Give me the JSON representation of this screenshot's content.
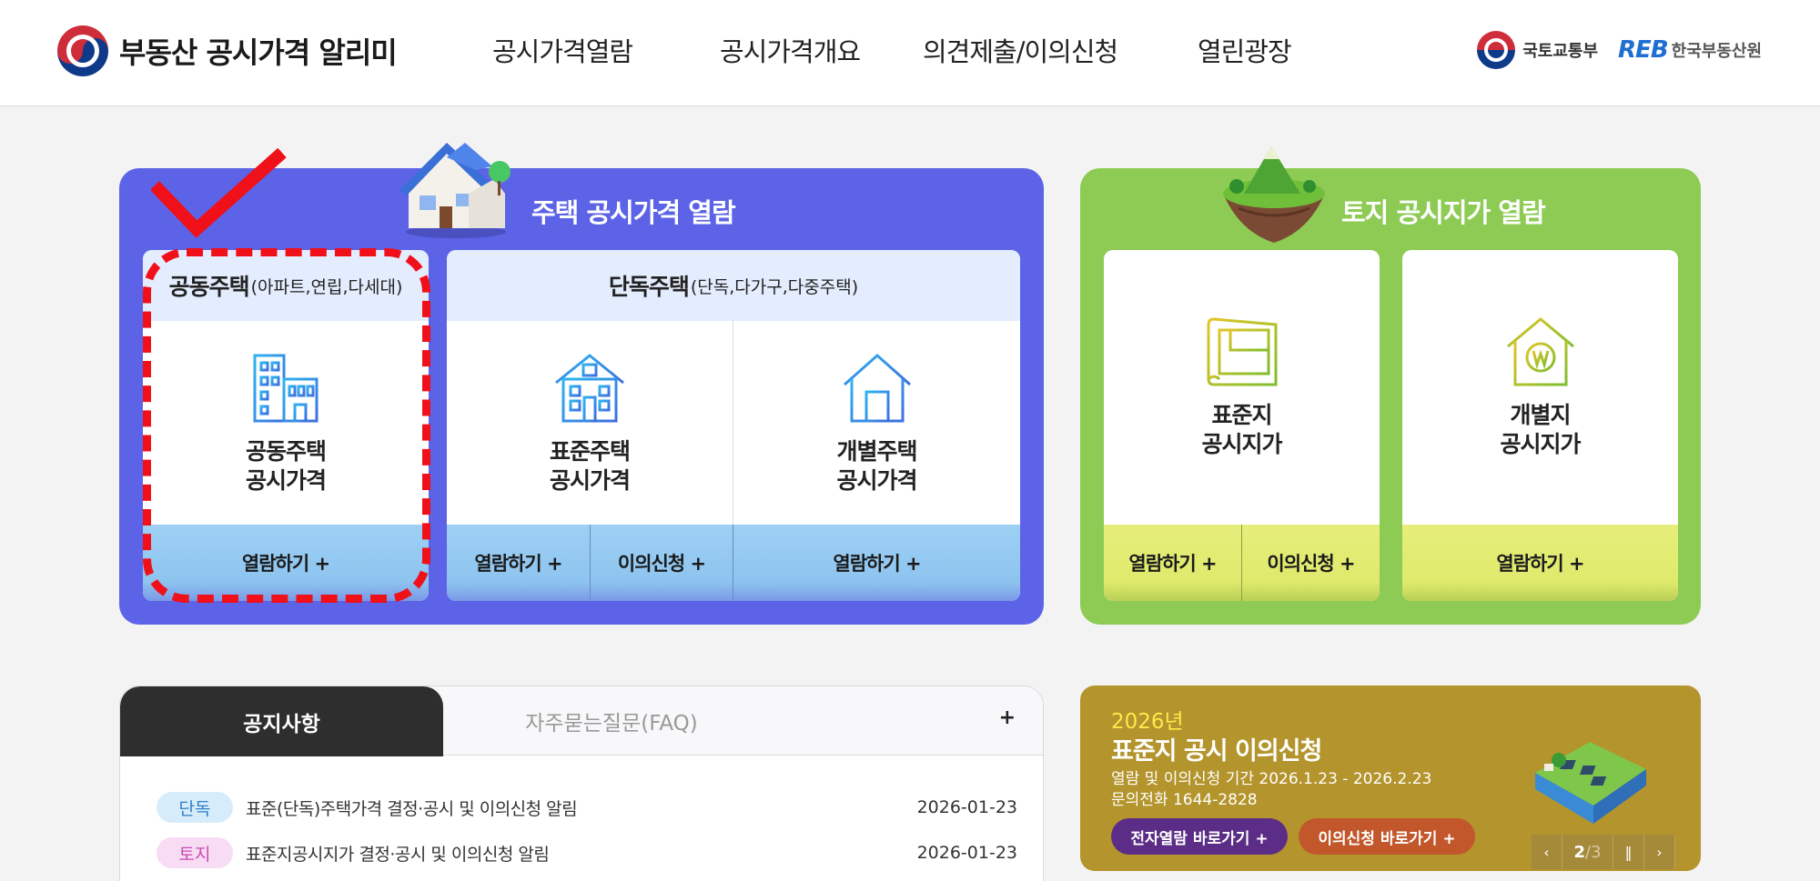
{
  "header": {
    "logo_text_regular": "부동산 공시가격 ",
    "logo_text_bold": "알리미",
    "nav": [
      "공시가격열람",
      "공시가격개요",
      "의견제출/이의신청",
      "열린광장"
    ],
    "ministry": "국토교통부",
    "reb_mark": "REB",
    "reb_text": "한국부동산원"
  },
  "housing": {
    "title": "주택 공시가격 열람",
    "apartment": {
      "head_main": "공동주택",
      "head_sub": "(아파트,연립,다세대)",
      "tile_label": "공동주택\n공시가격",
      "view_btn": "열람하기 +"
    },
    "detached": {
      "head_main": "단독주택",
      "head_sub": "(단독,다가구,다중주택)",
      "standard_label": "표준주택\n공시가격",
      "individual_label": "개별주택\n공시가격",
      "view_btn": "열람하기 +",
      "appeal_btn": "이의신청 +",
      "view_btn2": "열람하기 +"
    }
  },
  "land": {
    "title": "토지 공시지가 열람",
    "standard_label": "표준지\n공시지가",
    "individual_label": "개별지\n공시지가",
    "view_btn": "열람하기 +",
    "appeal_btn": "이의신청 +",
    "view_btn2": "열람하기 +"
  },
  "notice": {
    "tab_active": "공지사항",
    "tab_faq": "자주묻는질문(FAQ)",
    "more": "+",
    "rows": [
      {
        "badge": "단독",
        "text": "표준(단독)주택가격 결정·공시 및 이의신청 알림",
        "date": "2026-01-23"
      },
      {
        "badge": "토지",
        "text": "표준지공시지가 결정·공시 및 이의신청 알림",
        "date": "2026-01-23"
      }
    ]
  },
  "banner": {
    "year": "2026년",
    "title": "표준지 공시 이의신청",
    "line1": "열람 및 이의신청 기간 2026.1.23 - 2026.2.23",
    "line2": "문의전화 1644-2828",
    "btn_view": "전자열람 바로가기 +",
    "btn_appeal": "이의신청 바로가기 +",
    "pager_current": "2",
    "pager_sep": "/",
    "pager_total": "3"
  },
  "colors": {
    "housing_panel": "#5c63e6",
    "land_panel": "#8ecb55",
    "banner": "#b4942c",
    "highlight": "#f0101a"
  }
}
